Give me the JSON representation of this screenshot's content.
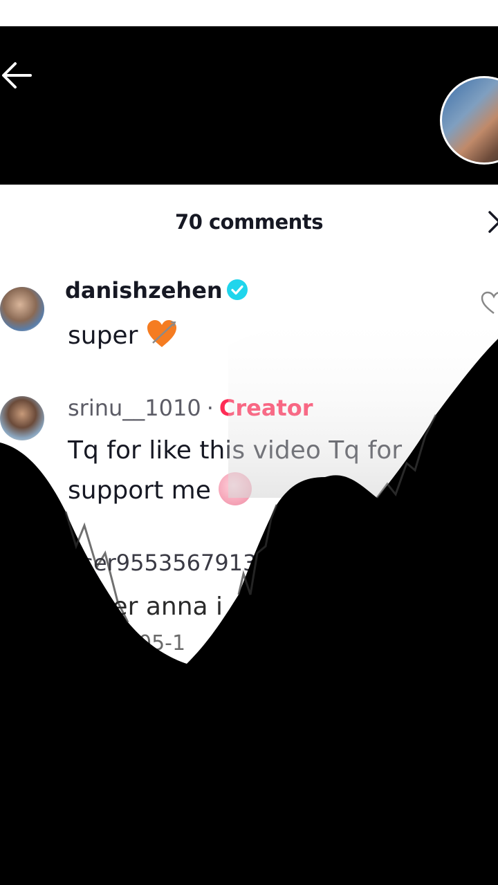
{
  "header": {
    "back_icon": "arrow-left-icon"
  },
  "comments_panel": {
    "count_label": "70 comments",
    "close_icon": "close-icon",
    "comments": [
      {
        "username": "danishzehen",
        "verified": true,
        "text": "super",
        "emoji": "orange-heart-with-arrow-emoji"
      },
      {
        "username": "srinu__1010",
        "separator": "·",
        "badge": "Creator",
        "text_line1": "Tq for like this video Tq for",
        "text_line2": "support me",
        "emoji": "squinting-laugh-emoji"
      },
      {
        "username": "user9553567913",
        "text": "super anna i d",
        "date": "05-1"
      }
    ]
  },
  "colors": {
    "creator_badge": "#fe2c55",
    "verified": "#20d5ec",
    "text_primary": "#161823"
  }
}
